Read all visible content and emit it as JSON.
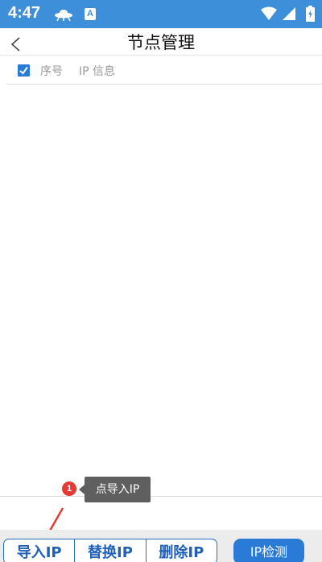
{
  "status_bar": {
    "time": "4:47",
    "a_icon": "A",
    "icons": [
      "ufo-icon",
      "a-icon",
      "wifi-icon",
      "signal-icon",
      "battery-icon"
    ]
  },
  "header": {
    "title": "节点管理",
    "back_icon": "chevron-left-icon"
  },
  "table": {
    "columns": [
      "序号",
      "IP 信息"
    ],
    "rows": []
  },
  "tooltip": {
    "step": "1",
    "text": "点导入IP"
  },
  "bottom_bar": {
    "import_label": "导入IP",
    "replace_label": "替换IP",
    "delete_label": "删除IP",
    "check_label": "IP检测"
  },
  "colors": {
    "status_bar": "#3d8fd9",
    "accent": "#2a7bd6",
    "button_text": "#1f5fb8",
    "badge": "#e53935",
    "tooltip_bg": "#5f5f5f"
  }
}
